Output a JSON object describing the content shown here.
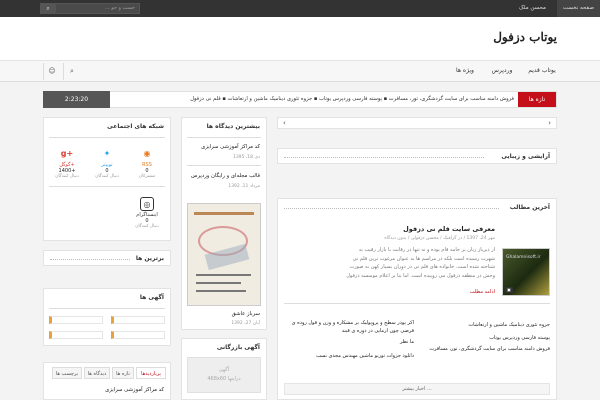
{
  "topbar": {
    "home": "صفحه نخست",
    "user": "محسن ملک",
    "search_placeholder": "جست و جو ..."
  },
  "header": {
    "logo": "یوتاب دزفول"
  },
  "nav": {
    "items": [
      "یوتاب قدیم",
      "وردپرس",
      "ویژه ها"
    ]
  },
  "breaking": {
    "label": "تازه ها",
    "ticker": "فروش دامنه مناسب برای سایت گردشگری، تور، مسافرت  ▪  پوسته فارسی وردپرس یوتاب  ▪  جزوه تئوری دینامیک ماشین و ارتعاشات  ▪  قلم نی دزفول",
    "time": "2:23:20"
  },
  "social": {
    "title": "شبکه های اجتماعی",
    "rss_label": "RSS",
    "rss_sub": "مشترکان",
    "twitter_label": "توییتر",
    "twitter_sub": "دنبال کنندگان",
    "gplus_label": "گوگل+",
    "gplus_sub": "دنبال کنندگان",
    "gplus_count": "1400+",
    "insta_label": "اینستاگرام",
    "insta_sub": "دنبال کنندگان",
    "zero": "0"
  },
  "top_box": {
    "title": "برترین ها"
  },
  "ads_box": {
    "title": "آگهی ها"
  },
  "popular": {
    "title": "بیشترین دیدگاه ها",
    "items": [
      {
        "title": "کد مراکز آموزشی سرایزی",
        "date": "دی 18، 1395"
      },
      {
        "title": "قالب مجله‌ای و رایگان وردپرس",
        "date": "مرداد 11، 1392"
      },
      {
        "title": "سرباز عاشق",
        "date": "آبان 27، 1392"
      }
    ]
  },
  "ads_banner": {
    "title": "آگهی بازرگانی",
    "ad_line1": "آگهی",
    "ad_line2": "468x60 درایتها"
  },
  "sliderbox": {
    "title": "آرایشی و زیبایی"
  },
  "latest": {
    "title": "آخرین مطالب",
    "featured_title": "معرفی سایت قلم نی دزفول",
    "featured_meta": "مهر 24، 1397  /  در گرافیک  /  محسن دزفولی  /  بدون دیدگاه",
    "featured_excerpt": "از دیرباز زنان بر خامه قام بوده و نه تنها در رقابت با بازار رقیب به شهرت رسیده است بلکه در مراسم ها به عنوان مرغوب ترین قلم نی شناخته شده است. خانواده های قلم نی در دوران بسیار کهن به صورت وحش در منطقه دزفول می روییده است. اما بنا بر اعلام موسسه دزفول شناس از حدود ...",
    "read_more": "ادامه مطلب",
    "thumb_text": "Ghalamnisoft.ir",
    "list_right": [
      "جزوه تئوری دینامیک ماشین و ارتعاشات",
      "پوسته فارسی وردپرس یوتاب",
      "فروش دامنه مناسب برای سایت گردشگری، تور، مسافرت"
    ],
    "list_left": [
      "اکر پودر سطح و پروپولیک بر مشکاره و وزن و قول روده ی قرصی چون ازمایی در دوره ی قبند",
      "ما نظر",
      "دانلود جزوات توربو ماشین مهندس مجدی نسب"
    ],
    "more": "اخبار بیشتر ..."
  },
  "tabs_widget": {
    "tabs": [
      "پربازدیدها",
      "تازه ها",
      "دیدگاه ها",
      "برچسب ها"
    ],
    "first_item": "کد مراکز آموزشی سرایزی"
  },
  "colors": {
    "accent": "#c40e1a",
    "dark": "#333333"
  }
}
